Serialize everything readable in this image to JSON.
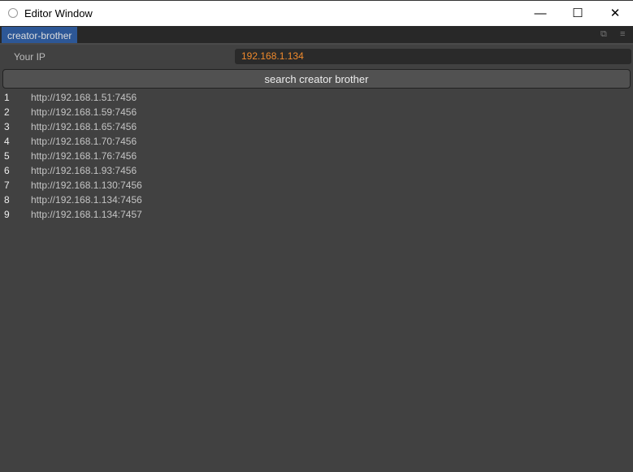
{
  "window": {
    "title": "Editor Window",
    "minimize": "—",
    "maximize": "☐",
    "close": "✕"
  },
  "tab": {
    "label": "creator-brother"
  },
  "form": {
    "ip_label": "Your IP",
    "ip_value": "192.168.1.134",
    "search_label": "search creator brother"
  },
  "results": [
    {
      "n": "1",
      "url": "http://192.168.1.51:7456"
    },
    {
      "n": "2",
      "url": "http://192.168.1.59:7456"
    },
    {
      "n": "3",
      "url": "http://192.168.1.65:7456"
    },
    {
      "n": "4",
      "url": "http://192.168.1.70:7456"
    },
    {
      "n": "5",
      "url": "http://192.168.1.76:7456"
    },
    {
      "n": "6",
      "url": "http://192.168.1.93:7456"
    },
    {
      "n": "7",
      "url": "http://192.168.1.130:7456"
    },
    {
      "n": "8",
      "url": "http://192.168.1.134:7456"
    },
    {
      "n": "9",
      "url": "http://192.168.1.134:7457"
    }
  ],
  "colors": {
    "accent_tab": "#2d5796",
    "ip_text": "#f08a2c"
  }
}
